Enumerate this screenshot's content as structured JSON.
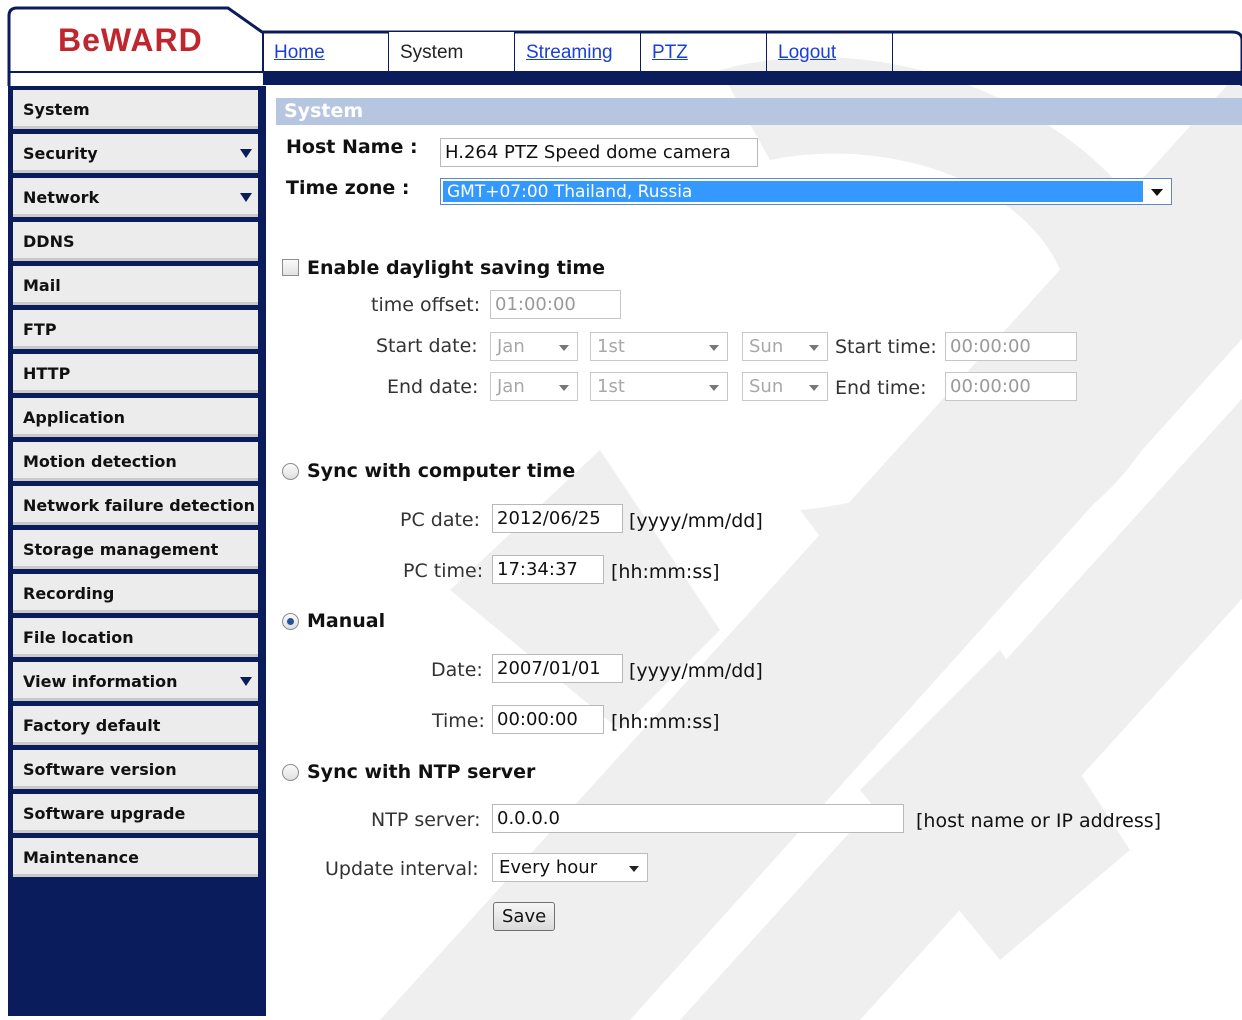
{
  "brand": {
    "logo_text": "BeWARD",
    "logo_color": "#c0262e",
    "nav_color": "#0b1c5c"
  },
  "tabs": [
    {
      "label": "Home",
      "active": false
    },
    {
      "label": "System",
      "active": true
    },
    {
      "label": "Streaming",
      "active": false
    },
    {
      "label": "PTZ",
      "active": false
    },
    {
      "label": "Logout",
      "active": false
    }
  ],
  "sidebar": {
    "items": [
      {
        "label": "System",
        "has_submenu": false
      },
      {
        "label": "Security",
        "has_submenu": true
      },
      {
        "label": "Network",
        "has_submenu": true
      },
      {
        "label": "DDNS",
        "has_submenu": false
      },
      {
        "label": "Mail",
        "has_submenu": false
      },
      {
        "label": "FTP",
        "has_submenu": false
      },
      {
        "label": "HTTP",
        "has_submenu": false
      },
      {
        "label": "Application",
        "has_submenu": false
      },
      {
        "label": "Motion detection",
        "has_submenu": false
      },
      {
        "label": "Network failure detection",
        "has_submenu": false
      },
      {
        "label": "Storage management",
        "has_submenu": false
      },
      {
        "label": "Recording",
        "has_submenu": false
      },
      {
        "label": "File location",
        "has_submenu": false
      },
      {
        "label": "View information",
        "has_submenu": true
      },
      {
        "label": "Factory default",
        "has_submenu": false
      },
      {
        "label": "Software version",
        "has_submenu": false
      },
      {
        "label": "Software upgrade",
        "has_submenu": false
      },
      {
        "label": "Maintenance",
        "has_submenu": false
      }
    ]
  },
  "page": {
    "section_title": "System",
    "host_name_label": "Host Name :",
    "host_name_value": "H.264 PTZ Speed dome camera",
    "time_zone_label": "Time zone :",
    "time_zone_value": "GMT+07:00 Thailand, Russia"
  },
  "dst": {
    "enable_label": "Enable daylight saving time",
    "checked": false,
    "time_offset_label": "time offset:",
    "time_offset_value": "01:00:00",
    "start_date_label": "Start date:",
    "start_month": "Jan",
    "start_day": "1st",
    "start_weekday": "Sun",
    "start_time_label": "Start time:",
    "start_time_value": "00:00:00",
    "end_date_label": "End date:",
    "end_month": "Jan",
    "end_day": "1st",
    "end_weekday": "Sun",
    "end_time_label": "End time:",
    "end_time_value": "00:00:00"
  },
  "sync_pc": {
    "label": "Sync with computer time",
    "selected": false,
    "pc_date_label": "PC date:",
    "pc_date_value": "2012/06/25",
    "pc_date_format": "[yyyy/mm/dd]",
    "pc_time_label": "PC time:",
    "pc_time_value": "17:34:37",
    "pc_time_format": "[hh:mm:ss]"
  },
  "manual": {
    "label": "Manual",
    "selected": true,
    "date_label": "Date:",
    "date_value": "2007/01/01",
    "date_format": "[yyyy/mm/dd]",
    "time_label": "Time:",
    "time_value": "00:00:00",
    "time_format": "[hh:mm:ss]"
  },
  "ntp": {
    "label": "Sync with NTP server",
    "selected": false,
    "server_label": "NTP server:",
    "server_value": "0.0.0.0",
    "server_hint": "[host name or IP address]",
    "interval_label": "Update interval:",
    "interval_value": "Every hour"
  },
  "actions": {
    "save_label": "Save"
  }
}
